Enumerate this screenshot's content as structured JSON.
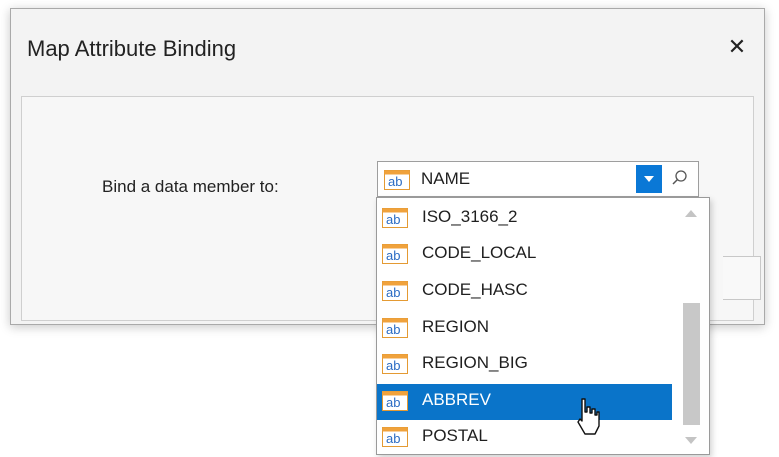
{
  "dialog": {
    "title": "Map Attribute Binding",
    "close_symbol": "✕"
  },
  "form": {
    "bind_label": "Bind a data member to:"
  },
  "lookup": {
    "selected_value": "NAME",
    "field_icon_text": "ab"
  },
  "dropdown": {
    "items": [
      {
        "label": "ISO_3166_2",
        "icon": "ab"
      },
      {
        "label": "CODE_LOCAL",
        "icon": "ab"
      },
      {
        "label": "CODE_HASC",
        "icon": "ab"
      },
      {
        "label": "REGION",
        "icon": "ab"
      },
      {
        "label": "REGION_BIG",
        "icon": "ab"
      },
      {
        "label": "ABBREV",
        "icon": "ab"
      },
      {
        "label": "POSTAL",
        "icon": "ab"
      }
    ],
    "highlighted_item": "ABBREV"
  },
  "colors": {
    "accent": "#0a78d6",
    "selection": "#0a74c9",
    "field_icon_orange": "#f0a23c",
    "field_icon_blue": "#2b6cc4"
  },
  "icons": {
    "dropdown": "chevron-down-icon",
    "search": "search-icon",
    "field": "text-field-icon",
    "close": "close-icon",
    "cursor": "mouse-pointer-icon"
  }
}
